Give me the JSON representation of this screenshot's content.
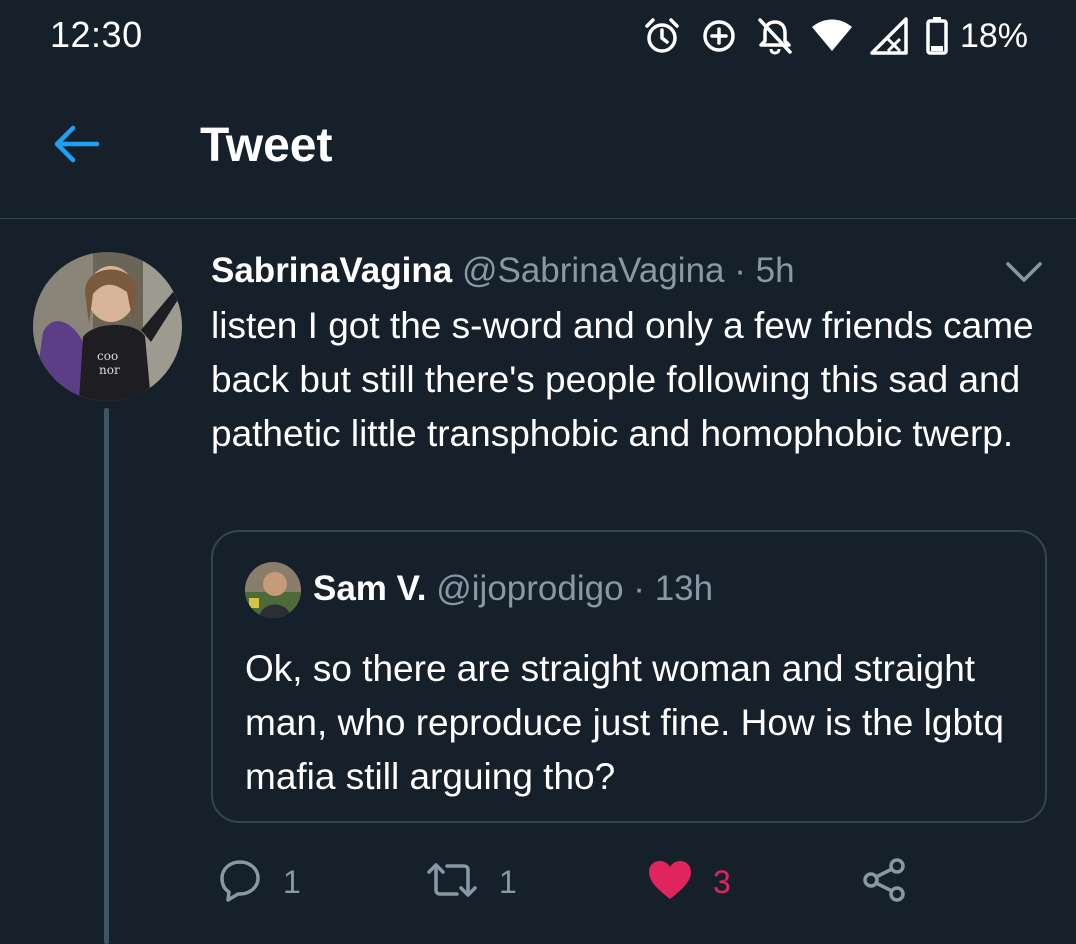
{
  "status_bar": {
    "time": "12:30",
    "icons": [
      "alarm-icon",
      "data-saver-icon",
      "notifications-off-icon",
      "wifi-icon",
      "signal-icon",
      "battery-icon"
    ],
    "battery_percent": "18%"
  },
  "header": {
    "back_icon": "arrow-left-icon",
    "title": "Tweet"
  },
  "tweet": {
    "author": {
      "display_name": "SabrinaVagina",
      "handle": "@SabrinaVagina"
    },
    "separator": "·",
    "time": "5h",
    "text": "listen I got the s-word and only a few friends came back but still there's people following this sad and pathetic little transphobic and homophobic twerp.",
    "quote": {
      "display_name": "Sam V.",
      "handle": "@ijoprodigo",
      "separator": "·",
      "time": "13h",
      "text": "Ok, so there are straight woman and straight man, who reproduce just fine. How is the lgbtq mafia still arguing tho?"
    },
    "actions": {
      "reply_count": "1",
      "retweet_count": "1",
      "like_count": "3",
      "liked": true
    }
  },
  "colors": {
    "background": "#15202b",
    "accent": "#1da1f2",
    "muted": "#8899a6",
    "border": "#38444d",
    "like": "#e0245e"
  }
}
